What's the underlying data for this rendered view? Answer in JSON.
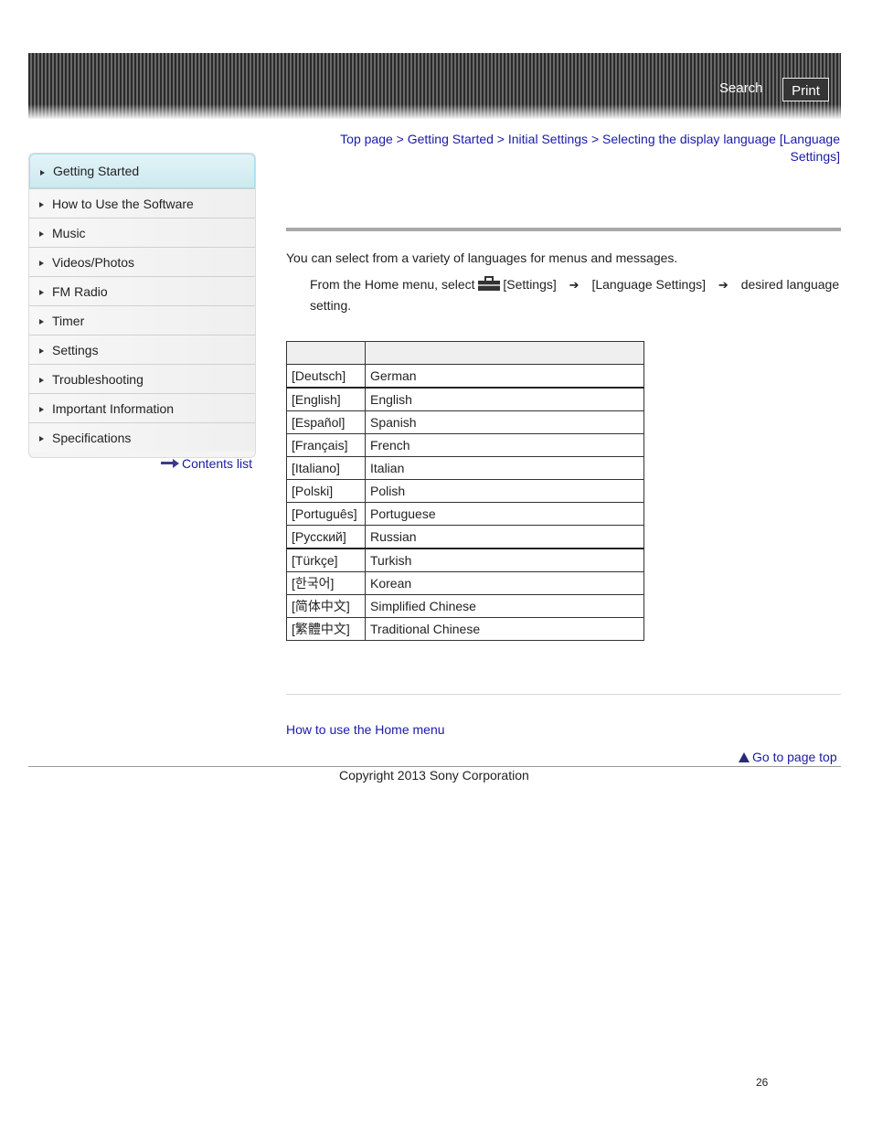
{
  "header": {
    "search_label": "Search",
    "print_label": "Print"
  },
  "sidebar": {
    "items": [
      {
        "label": "Getting Started",
        "active": true
      },
      {
        "label": "How to Use the Software"
      },
      {
        "label": "Music"
      },
      {
        "label": "Videos/Photos"
      },
      {
        "label": "FM Radio"
      },
      {
        "label": "Timer"
      },
      {
        "label": "Settings"
      },
      {
        "label": "Troubleshooting"
      },
      {
        "label": "Important Information"
      },
      {
        "label": "Specifications"
      }
    ],
    "contents_list": "Contents list"
  },
  "breadcrumb": {
    "items": [
      "Top page",
      "Getting Started",
      "Initial Settings",
      "Selecting the display language [Language Settings]"
    ],
    "separator": ">"
  },
  "content": {
    "intro": "You can select from a variety of languages for menus and messages.",
    "step": {
      "prefix": "From the Home menu, select",
      "settings": "[Settings]",
      "language_settings": "[Language Settings]",
      "suffix": "desired language setting."
    },
    "table": {
      "headers": [
        "",
        ""
      ],
      "rows": [
        [
          "[Deutsch]",
          "German"
        ],
        [
          "[English]",
          "English"
        ],
        [
          "[Español]",
          "Spanish"
        ],
        [
          "[Français]",
          "French"
        ],
        [
          "[Italiano]",
          "Italian"
        ],
        [
          "[Polski]",
          "Polish"
        ],
        [
          "[Português]",
          "Portuguese"
        ],
        [
          "[Русский]",
          "Russian"
        ],
        [
          "[Türkçe]",
          "Turkish"
        ],
        [
          "[한국어]",
          "Korean"
        ],
        [
          "[简体中文]",
          "Simplified Chinese"
        ],
        [
          "[繁體中文]",
          "Traditional Chinese"
        ]
      ]
    },
    "related_link": "How to use the Home menu",
    "go_top": "Go to page top"
  },
  "footer": {
    "copyright": "Copyright 2013 Sony Corporation",
    "page_number": "26"
  }
}
